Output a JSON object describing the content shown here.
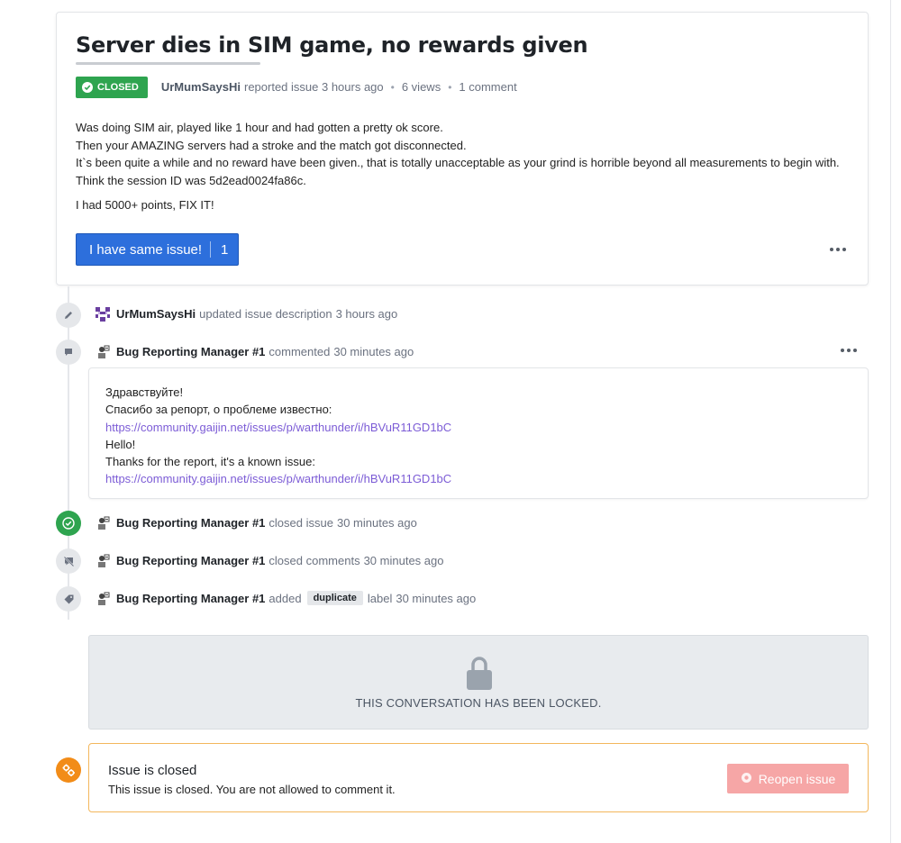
{
  "issue": {
    "title": "Server dies in SIM game, no rewards given",
    "status": "CLOSED",
    "status_color": "#2ea44f",
    "author": "UrMumSaysHi",
    "reported": "reported issue 3 hours ago",
    "views": "6 views",
    "comments_count": "1 comment",
    "body_lines": [
      "Was doing SIM air, played like 1 hour and had gotten a pretty ok score.",
      "Then your AMAZING servers had a stroke and the match got disconnected.",
      "It`s been quite a while and no reward have been given., that is totally unacceptable as your grind is horrible beyond all measurements to begin with.",
      "Think the session ID was 5d2ead0024fa86c."
    ],
    "body_p2": "I had 5000+ points, FIX IT!",
    "same_issue_label": "I have same issue!",
    "same_issue_count": "1"
  },
  "timeline": {
    "updated": {
      "who": "UrMumSaysHi",
      "what": "updated issue description",
      "when": "3 hours ago"
    },
    "commented": {
      "who": "Bug Reporting Manager #1",
      "what": "commented",
      "when": "30 minutes ago"
    },
    "closed": {
      "who": "Bug Reporting Manager #1",
      "what": "closed issue",
      "when": "30 minutes ago"
    },
    "closed_comments": {
      "who": "Bug Reporting Manager #1",
      "what": "closed comments",
      "when": "30 minutes ago"
    },
    "label_added": {
      "who": "Bug Reporting Manager #1",
      "what": "added",
      "label": "duplicate",
      "after": "label",
      "when": "30 minutes ago"
    }
  },
  "comment": {
    "line1": "Здравствуйте!",
    "line2": "Спасибо за репорт, о проблеме известно:",
    "link1": "https://community.gaijin.net/issues/p/warthunder/i/hBVuR11GD1bC",
    "line3": "Hello!",
    "line4": "Thanks for the report, it's a known issue:",
    "link2": "https://community.gaijin.net/issues/p/warthunder/i/hBVuR11GD1bC"
  },
  "locked_message": "THIS CONVERSATION HAS BEEN LOCKED.",
  "closed_notice": {
    "heading": "Issue is closed",
    "text": "This issue is closed. You are not allowed to comment it.",
    "reopen_label": "Reopen issue"
  },
  "icons": {
    "status": "check-circle-icon",
    "edit": "pencil-icon",
    "comment": "comment-icon",
    "closed": "check-icon",
    "comments_closed": "comment-off-icon",
    "label": "tag-icon",
    "lock": "lock-icon",
    "notice": "gears-icon",
    "reopen": "bug-icon",
    "more": "more-horizontal-icon"
  },
  "colors": {
    "primary": "#2d6fdc",
    "closed_green": "#2ea44f",
    "link": "#7c5cd6",
    "notice_border": "#f3b75c",
    "notice_icon": "#f28c18",
    "reopen": "#f6a6a6"
  }
}
